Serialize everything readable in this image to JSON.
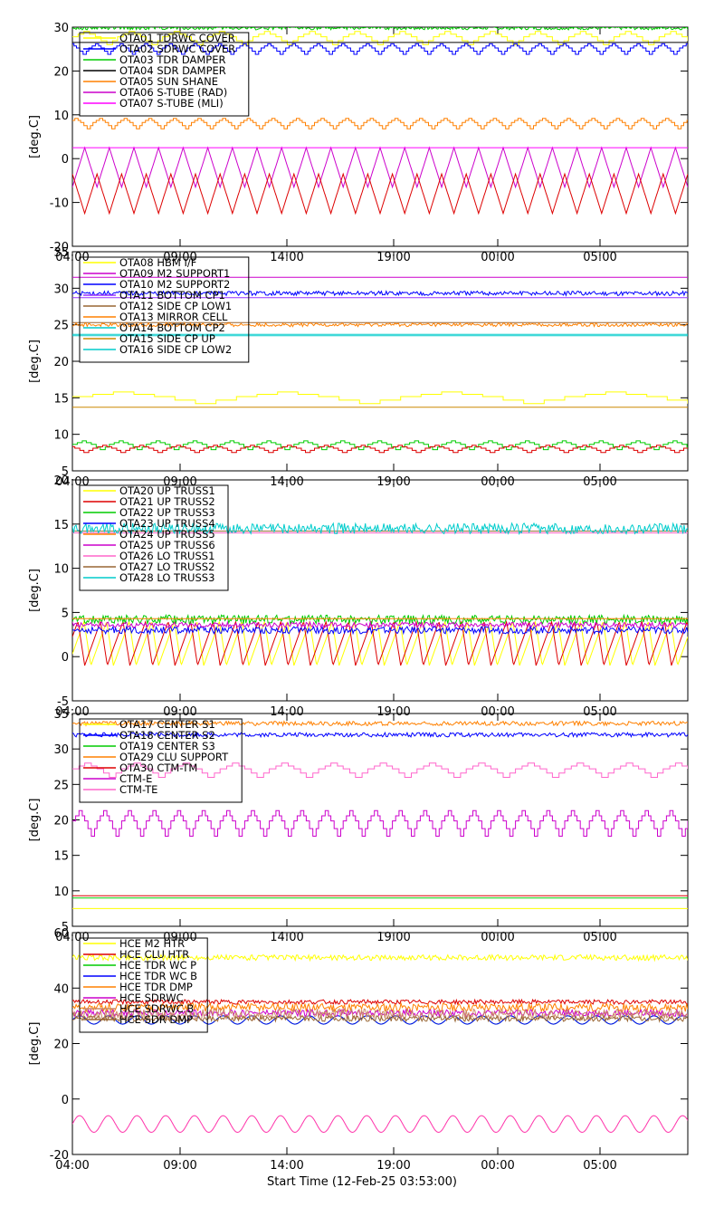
{
  "page": {
    "x_title": "Start Time (12-Feb-25 03:53:00)"
  },
  "chart_data": [
    {
      "type": "line",
      "ylabel": "[deg.C]",
      "ylim": [
        -20,
        30
      ],
      "yticks": [
        -20,
        -10,
        0,
        10,
        20,
        30
      ],
      "xlim": [
        0,
        1500
      ],
      "x_tick_labels": [
        "04:00",
        "09:00",
        "14:00",
        "19:00",
        "00:00",
        "05:00"
      ],
      "legend_position": "top-left",
      "series": [
        {
          "name": "OTA01 TDRWC COVER",
          "color": "#ffff00",
          "kind": "step",
          "base": 27.5,
          "amp": 1.5,
          "period": 110,
          "phase": 0
        },
        {
          "name": "OTA02 SDRWC COVER",
          "color": "#0000ff",
          "kind": "step",
          "base": 25,
          "amp": 1.2,
          "period": 60,
          "phase": 20
        },
        {
          "name": "OTA03 TDR DAMPER",
          "color": "#00cc00",
          "kind": "noise",
          "base": 29.8,
          "amp": 0.4,
          "period": 20,
          "phase": 0
        },
        {
          "name": "OTA04 SDR DAMPER",
          "color": "#000000",
          "kind": "flat",
          "base": 26.5,
          "amp": 0,
          "period": 60,
          "phase": 0
        },
        {
          "name": "OTA05 SUN SHANE",
          "color": "#ff8000",
          "kind": "step",
          "base": 8,
          "amp": 1.2,
          "period": 60,
          "phase": 10
        },
        {
          "name": "OTA06 S-TUBE (RAD)",
          "color": "#cc00cc",
          "kind": "tri",
          "base": -2,
          "amp": 4.5,
          "period": 60,
          "phase": 0
        },
        {
          "name": "OTA07 S-TUBE (MLI)",
          "color": "#ff00ff",
          "kind": "flat",
          "base": 2.5,
          "amp": 0,
          "period": 60,
          "phase": 0
        },
        {
          "name": "",
          "color": "#dd0000",
          "kind": "tri",
          "base": -8,
          "amp": 4.5,
          "period": 60,
          "phase": 30
        }
      ]
    },
    {
      "type": "line",
      "ylabel": "[deg.C]",
      "ylim": [
        5,
        35
      ],
      "yticks": [
        5,
        10,
        15,
        20,
        25,
        30,
        35
      ],
      "xlim": [
        0,
        1500
      ],
      "x_tick_labels": [
        "04:00",
        "09:00",
        "14:00",
        "19:00",
        "00:00",
        "05:00"
      ],
      "legend_position": "top-left",
      "series": [
        {
          "name": "OTA08 HBM I/F",
          "color": "#ffff00",
          "kind": "step",
          "base": 15,
          "amp": 0.8,
          "period": 400,
          "phase": 0
        },
        {
          "name": "OTA09 M2 SUPPORT1",
          "color": "#cc00cc",
          "kind": "flat",
          "base": 31.5,
          "amp": 0,
          "period": 60,
          "phase": 0
        },
        {
          "name": "OTA10 M2 SUPPORT2",
          "color": "#0000ff",
          "kind": "noise",
          "base": 29.3,
          "amp": 0.3,
          "period": 20,
          "phase": 0
        },
        {
          "name": "OTA11 BOTTOM CP1",
          "color": "#9933ff",
          "kind": "flat",
          "base": 28.7,
          "amp": 0,
          "period": 60,
          "phase": 0
        },
        {
          "name": "OTA12 SIDE CP LOW1",
          "color": "#996633",
          "kind": "flat",
          "base": 25.3,
          "amp": 0,
          "period": 60,
          "phase": 0
        },
        {
          "name": "OTA13 MIRROR CELL",
          "color": "#ff8000",
          "kind": "noise",
          "base": 25,
          "amp": 0.25,
          "period": 20,
          "phase": 0
        },
        {
          "name": "OTA14 BOTTOM CP2",
          "color": "#00cccc",
          "kind": "flat",
          "base": 23.7,
          "amp": 0,
          "period": 60,
          "phase": 0
        },
        {
          "name": "OTA15 SIDE CP UP",
          "color": "#cc8800",
          "kind": "flat",
          "base": 13.7,
          "amp": 0,
          "period": 60,
          "phase": 0
        },
        {
          "name": "OTA16 SIDE CP LOW2",
          "color": "#00cccc",
          "kind": "flat",
          "base": 23.5,
          "amp": 0,
          "period": 60,
          "phase": 0
        },
        {
          "name": "",
          "color": "#00cc00",
          "kind": "step",
          "base": 8.5,
          "amp": 0.6,
          "period": 90,
          "phase": 0
        },
        {
          "name": "",
          "color": "#dd0000",
          "kind": "step",
          "base": 8,
          "amp": 0.5,
          "period": 90,
          "phase": 40
        }
      ]
    },
    {
      "type": "line",
      "ylabel": "[deg.C]",
      "ylim": [
        -5,
        20
      ],
      "yticks": [
        -5,
        0,
        5,
        10,
        15,
        20
      ],
      "xlim": [
        0,
        1500
      ],
      "x_tick_labels": [
        "04:00",
        "09:00",
        "14:00",
        "19:00",
        "00:00",
        "05:00"
      ],
      "legend_position": "top-left",
      "series": [
        {
          "name": "OTA20 UP TRUSS1",
          "color": "#ffff00",
          "kind": "saw",
          "base": 1.5,
          "amp": 2.5,
          "period": 55,
          "phase": 10
        },
        {
          "name": "OTA21 UP TRUSS2",
          "color": "#dd0000",
          "kind": "saw",
          "base": 1.5,
          "amp": 2.5,
          "period": 55,
          "phase": 25
        },
        {
          "name": "OTA22 UP TRUSS3",
          "color": "#00cc00",
          "kind": "noise",
          "base": 4.2,
          "amp": 0.5,
          "period": 20,
          "phase": 0
        },
        {
          "name": "OTA23 UP TRUSS4",
          "color": "#0000ff",
          "kind": "noise",
          "base": 3,
          "amp": 0.4,
          "period": 20,
          "phase": 0
        },
        {
          "name": "OTA24 UP TRUSS5",
          "color": "#ff8000",
          "kind": "flat",
          "base": 4.3,
          "amp": 0,
          "period": 60,
          "phase": 0
        },
        {
          "name": "OTA25 UP TRUSS6",
          "color": "#cc00cc",
          "kind": "noise",
          "base": 3.6,
          "amp": 0.3,
          "period": 20,
          "phase": 0
        },
        {
          "name": "OTA26 LO TRUSS1",
          "color": "#ff66cc",
          "kind": "flat",
          "base": 14,
          "amp": 0,
          "period": 60,
          "phase": 0
        },
        {
          "name": "OTA27 LO TRUSS2",
          "color": "#996633",
          "kind": "flat",
          "base": 14.2,
          "amp": 0,
          "period": 60,
          "phase": 0
        },
        {
          "name": "OTA28 LO TRUSS3",
          "color": "#00cccc",
          "kind": "noise",
          "base": 14.5,
          "amp": 0.6,
          "period": 20,
          "phase": 0
        }
      ]
    },
    {
      "type": "line",
      "ylabel": "[deg.C]",
      "ylim": [
        5,
        35
      ],
      "yticks": [
        5,
        10,
        15,
        20,
        25,
        30,
        35
      ],
      "xlim": [
        0,
        1500
      ],
      "x_tick_labels": [
        "04:00",
        "09:00",
        "14:00",
        "19:00",
        "00:00",
        "05:00"
      ],
      "legend_position": "top-left",
      "series": [
        {
          "name": "OTA17 CENTER S1",
          "color": "#ffff00",
          "kind": "flat",
          "base": 7.5,
          "amp": 0,
          "period": 60,
          "phase": 0
        },
        {
          "name": "OTA18 CENTER S2",
          "color": "#0000ff",
          "kind": "noise",
          "base": 32,
          "amp": 0.3,
          "period": 20,
          "phase": 0
        },
        {
          "name": "OTA19 CENTER S3",
          "color": "#00cc00",
          "kind": "flat",
          "base": 9,
          "amp": 0,
          "period": 60,
          "phase": 0
        },
        {
          "name": "OTA29 CLU SUPPORT",
          "color": "#ff8000",
          "kind": "noise",
          "base": 33.6,
          "amp": 0.3,
          "period": 20,
          "phase": 0
        },
        {
          "name": "OTA30 CTM-TM",
          "color": "#dd0000",
          "kind": "flat",
          "base": 9.3,
          "amp": 0,
          "period": 60,
          "phase": 0
        },
        {
          "name": "CTM-E",
          "color": "#cc00cc",
          "kind": "step",
          "base": 19.5,
          "amp": 1.8,
          "period": 60,
          "phase": 0
        },
        {
          "name": "CTM-TE",
          "color": "#ff66cc",
          "kind": "step",
          "base": 27,
          "amp": 1,
          "period": 120,
          "phase": 0
        }
      ]
    },
    {
      "type": "line",
      "ylabel": "[deg.C]",
      "ylim": [
        -20,
        60
      ],
      "yticks": [
        -20,
        0,
        20,
        40,
        60
      ],
      "xlim": [
        0,
        1500
      ],
      "x_tick_labels": [
        "04:00",
        "09:00",
        "14:00",
        "19:00",
        "00:00",
        "05:00"
      ],
      "legend_position": "top-left",
      "series": [
        {
          "name": "HCE M2 HTR",
          "color": "#ffff00",
          "kind": "noise",
          "base": 51,
          "amp": 1,
          "period": 20,
          "phase": 0
        },
        {
          "name": "HCE CLU HTR",
          "color": "#dd0000",
          "kind": "noise",
          "base": 35,
          "amp": 0.8,
          "period": 20,
          "phase": 0
        },
        {
          "name": "HCE TDR WC P",
          "color": "#00cc00",
          "kind": "sine",
          "base": 28.5,
          "amp": 1.5,
          "period": 70,
          "phase": 0
        },
        {
          "name": "HCE TDR WC B",
          "color": "#0000ff",
          "kind": "sine",
          "base": 28.5,
          "amp": 1.5,
          "period": 70,
          "phase": 0
        },
        {
          "name": "HCE TDR DMP",
          "color": "#ff8000",
          "kind": "noise",
          "base": 33,
          "amp": 1.5,
          "period": 20,
          "phase": 0
        },
        {
          "name": "HCE SDRWC",
          "color": "#cc00cc",
          "kind": "noise",
          "base": 31,
          "amp": 1.2,
          "period": 20,
          "phase": 0
        },
        {
          "name": "HCE SDRWC B",
          "color": "#cc8866",
          "kind": "noise",
          "base": 30.5,
          "amp": 2,
          "period": 20,
          "phase": 0
        },
        {
          "name": "HCE SDR DMP",
          "color": "#996633",
          "kind": "noise",
          "base": 29,
          "amp": 1,
          "period": 20,
          "phase": 0
        },
        {
          "name": "",
          "color": "#ff33aa",
          "kind": "sine",
          "base": -9,
          "amp": 3,
          "period": 70,
          "phase": 0
        }
      ]
    }
  ]
}
